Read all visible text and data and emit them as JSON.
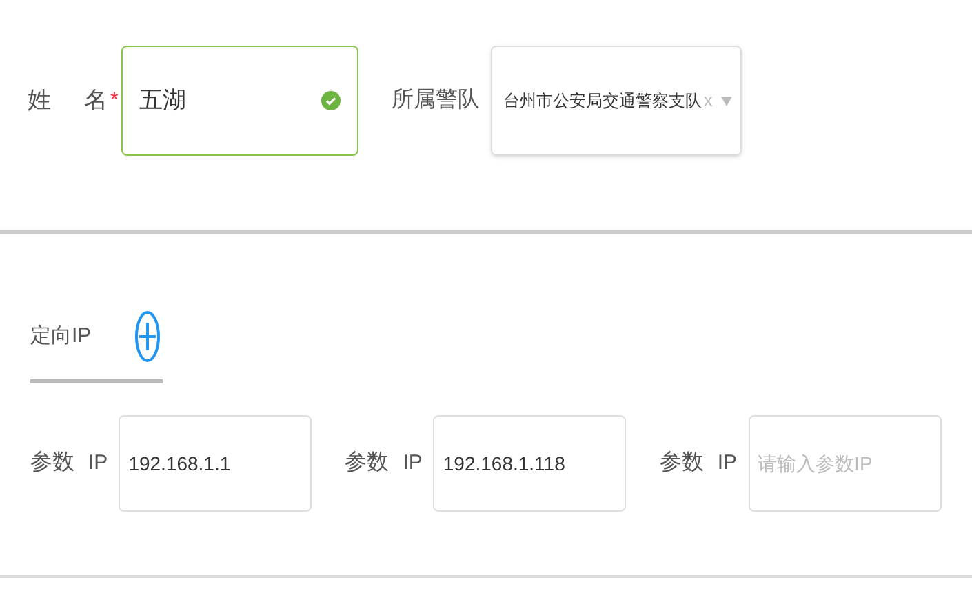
{
  "name_field": {
    "label_parts": [
      "姓",
      "名"
    ],
    "required_mark": "*",
    "value": "五湖",
    "valid": true
  },
  "team_field": {
    "label": "所属警队",
    "value": "台州市公安局交通警察支队",
    "clear": "x"
  },
  "section": {
    "title": "定向IP"
  },
  "ip_params": [
    {
      "label": "参数",
      "sub_label": "IP",
      "value": "192.168.1.1"
    },
    {
      "label": "参数",
      "sub_label": "IP",
      "value": "192.168.1.118"
    },
    {
      "label": "参数",
      "sub_label": "IP",
      "placeholder": "请输入参数IP"
    }
  ]
}
